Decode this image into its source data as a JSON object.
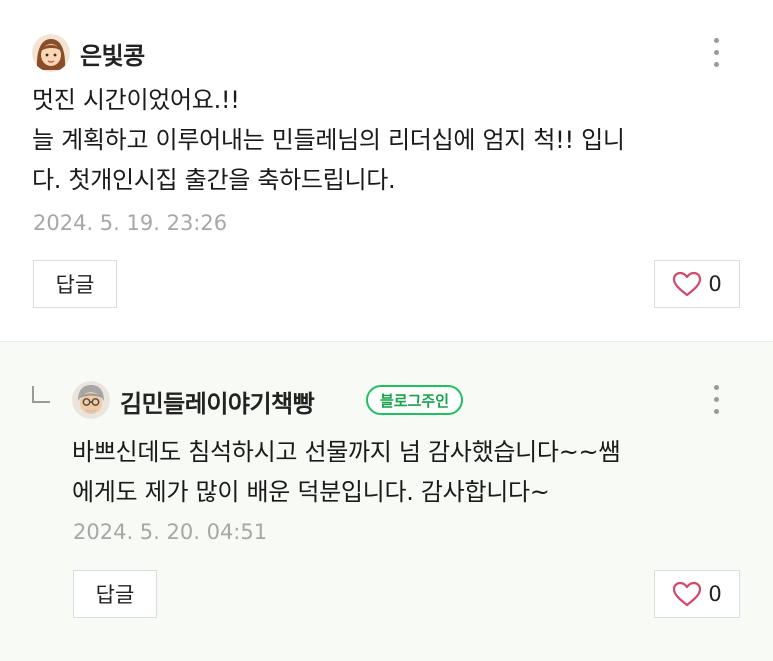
{
  "comments": [
    {
      "author": "은빛콩",
      "avatar_icon": "girl-avatar",
      "lines": [
        "멋진 시간이었어요.!!",
        "늘 계획하고 이루어내는 민들레님의 리더십에 엄지 척!! 입니",
        "다. 첫개인시집 출간을 축하드립니다."
      ],
      "date": "2024. 5. 19. 23:26",
      "reply_label": "답글",
      "like_count": "0"
    },
    {
      "author": "김민들레이야기책빵",
      "avatar_icon": "grandpa-avatar",
      "badge": "블로그주인",
      "lines": [
        "바쁘신데도  침석하시고 선물까지 넘  감사했습니다~~쌤",
        "에게도 제가  많이  배운 덕분입니다. 감사합니다~"
      ],
      "date": "2024. 5. 20. 04:51",
      "reply_label": "답글",
      "like_count": "0"
    }
  ],
  "colors": {
    "badge_green": "#1fbf62",
    "heart": "#d24a6b",
    "date_gray": "#a7a7a7",
    "reply_bg": "#f8faf6"
  }
}
